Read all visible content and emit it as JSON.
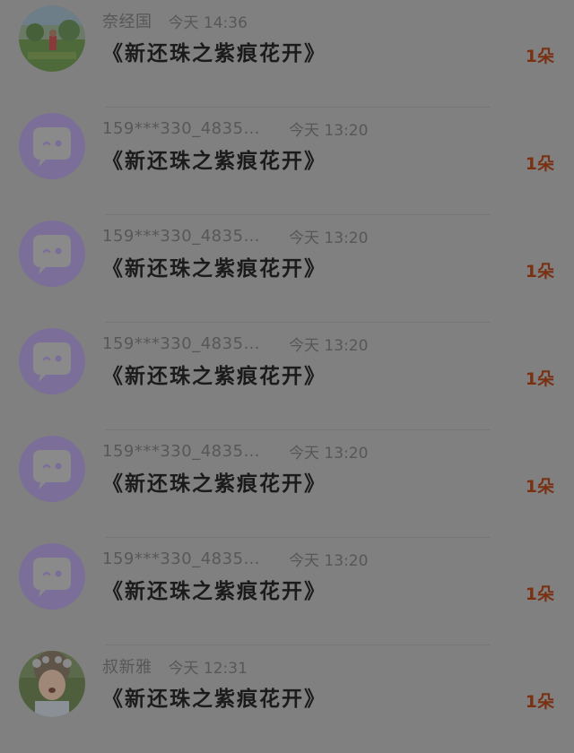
{
  "accent_color": "#7a3012",
  "items": [
    {
      "name": "奈经国",
      "time": "今天 14:36",
      "title": "《新还珠之紫痕花开》",
      "count": "1朵",
      "avatar": "photo-landscape"
    },
    {
      "name": "159***330_483557…",
      "time": "今天 13:20",
      "title": "《新还珠之紫痕花开》",
      "count": "1朵",
      "avatar": "default-chat-bubble-icon"
    },
    {
      "name": "159***330_483557…",
      "time": "今天 13:20",
      "title": "《新还珠之紫痕花开》",
      "count": "1朵",
      "avatar": "default-chat-bubble-icon"
    },
    {
      "name": "159***330_483557…",
      "time": "今天 13:20",
      "title": "《新还珠之紫痕花开》",
      "count": "1朵",
      "avatar": "default-chat-bubble-icon"
    },
    {
      "name": "159***330_483557…",
      "time": "今天 13:20",
      "title": "《新还珠之紫痕花开》",
      "count": "1朵",
      "avatar": "default-chat-bubble-icon"
    },
    {
      "name": "159***330_483557…",
      "time": "今天 13:20",
      "title": "《新还珠之紫痕花开》",
      "count": "1朵",
      "avatar": "default-chat-bubble-icon"
    },
    {
      "name": "叔新雅",
      "time": "今天 12:31",
      "title": "《新还珠之紫痕花开》",
      "count": "1朵",
      "avatar": "photo-girl"
    }
  ]
}
